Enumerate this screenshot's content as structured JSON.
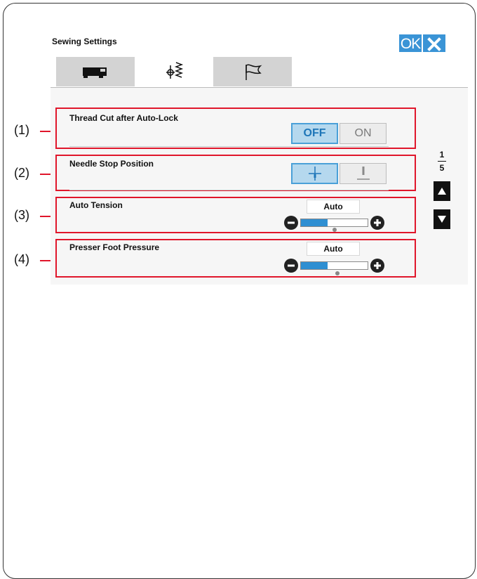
{
  "window": {
    "title": "Sewing Settings",
    "ok_label": "OK"
  },
  "tabs": [
    {
      "icon": "sewing-machine-icon",
      "active": false
    },
    {
      "icon": "stitch-settings-icon",
      "active": true
    },
    {
      "icon": "flag-icon",
      "active": false
    }
  ],
  "settings": {
    "thread_cut": {
      "label": "Thread Cut after Auto-Lock",
      "off": "OFF",
      "on": "ON",
      "selected": "OFF"
    },
    "needle_stop": {
      "label": "Needle Stop Position",
      "selected": "down"
    },
    "auto_tension": {
      "label": "Auto Tension",
      "value_label": "Auto",
      "level": 0.4
    },
    "presser_foot": {
      "label": "Presser Foot Pressure",
      "value_label": "Auto",
      "level": 0.4
    }
  },
  "pagination": {
    "current": "1",
    "total": "5"
  },
  "callouts": [
    "(1)",
    "(2)",
    "(3)",
    "(4)"
  ],
  "colors": {
    "accent": "#3a94d6",
    "callout": "#e0162b",
    "selected_bg": "#b5d8ee"
  }
}
